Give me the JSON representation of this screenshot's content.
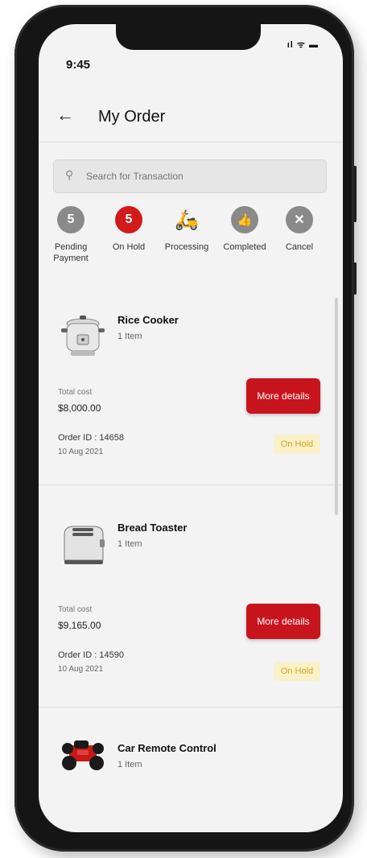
{
  "status_bar": {
    "time": "9:45",
    "icons": "ıl ᯤ ▬"
  },
  "header": {
    "back_icon": "←",
    "title": "My Order"
  },
  "search": {
    "icon": "🔍",
    "placeholder": "Search for Transaction"
  },
  "statuses": [
    {
      "icon": "5",
      "label": "Pending Payment",
      "active": false
    },
    {
      "icon": "5",
      "label": "On Hold",
      "active": true
    },
    {
      "icon": "🛵",
      "label": "Processing",
      "active": false
    },
    {
      "icon": "👍",
      "label": "Completed",
      "active": false
    },
    {
      "icon": "✕",
      "label": "Cancel",
      "active": false
    }
  ],
  "orders": [
    {
      "name": "Rice Cooker",
      "qty": "1 Item",
      "cost_label": "Total cost",
      "cost": "$8,000.00",
      "order_id": "Order ID : 14658",
      "date": "10 Aug 2021",
      "button": "More details",
      "status": "On Hold"
    },
    {
      "name": "Bread Toaster",
      "qty": "1 Item",
      "cost_label": "Total cost",
      "cost": "$9,165.00",
      "order_id": "Order ID : 14590",
      "date": "10 Aug 2021",
      "button": "More details",
      "status": "On Hold"
    },
    {
      "name": "Car Remote Control",
      "qty": "1 Item"
    }
  ],
  "colors": {
    "accent": "#c8141d",
    "badge_bg": "#fbf1c9",
    "badge_text": "#d4a21a",
    "screen_bg": "#f3f3f3"
  }
}
